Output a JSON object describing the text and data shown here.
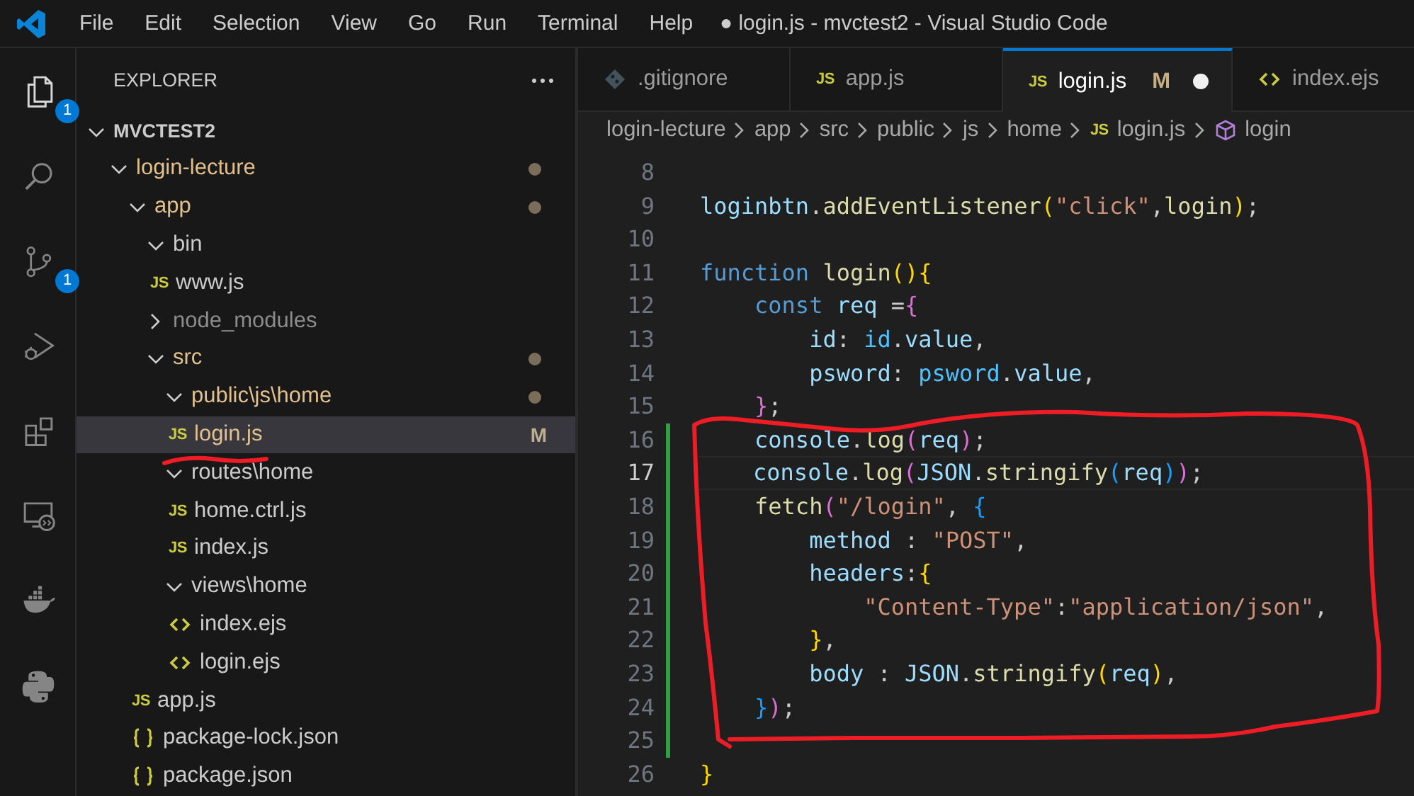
{
  "title_bar": {
    "menu": [
      "File",
      "Edit",
      "Selection",
      "View",
      "Go",
      "Run",
      "Terminal",
      "Help"
    ],
    "title": "● login.js - mvctest2 - Visual Studio Code"
  },
  "activity_bar": [
    {
      "kind": "explorer",
      "selected": true,
      "badge": "1"
    },
    {
      "kind": "search",
      "selected": false
    },
    {
      "kind": "source-control",
      "selected": false,
      "badge": "1"
    },
    {
      "kind": "run-debug",
      "selected": false
    },
    {
      "kind": "extensions",
      "selected": false
    },
    {
      "kind": "remote",
      "selected": false
    },
    {
      "kind": "docker",
      "selected": false
    },
    {
      "kind": "python",
      "selected": false
    }
  ],
  "explorer": {
    "title": "EXPLORER",
    "root": {
      "label": "MVCTEST2",
      "expanded": true
    },
    "tree": [
      {
        "label": "login-lecture",
        "kind": "folder",
        "expanded": true,
        "modified": true,
        "ignored": false,
        "selected": false,
        "children": [
          {
            "label": "app",
            "kind": "folder",
            "expanded": true,
            "modified": true,
            "ignored": false,
            "selected": false,
            "children": [
              {
                "label": "bin",
                "kind": "folder",
                "expanded": true,
                "modified": false,
                "ignored": false,
                "selected": false,
                "children": [
                  {
                    "label": "www.js",
                    "kind": "js",
                    "icon_label": "JS",
                    "modified": false,
                    "ignored": false,
                    "selected": false
                  }
                ]
              },
              {
                "label": "node_modules",
                "kind": "folder",
                "expanded": false,
                "modified": false,
                "ignored": true,
                "selected": false
              },
              {
                "label": "src",
                "kind": "folder",
                "expanded": true,
                "modified": true,
                "ignored": false,
                "selected": false,
                "children": [
                  {
                    "label": "public\\js\\home",
                    "kind": "folder",
                    "expanded": true,
                    "modified": true,
                    "ignored": false,
                    "selected": false,
                    "children": [
                      {
                        "label": "login.js",
                        "kind": "js",
                        "icon_label": "JS",
                        "modified": true,
                        "ignored": false,
                        "badge": "M",
                        "selected": true
                      }
                    ]
                  },
                  {
                    "label": "routes\\home",
                    "kind": "folder",
                    "expanded": true,
                    "modified": false,
                    "ignored": false,
                    "selected": false,
                    "children": [
                      {
                        "label": "home.ctrl.js",
                        "kind": "js",
                        "icon_label": "JS",
                        "modified": false,
                        "ignored": false,
                        "selected": false
                      },
                      {
                        "label": "index.js",
                        "kind": "js",
                        "icon_label": "JS",
                        "modified": false,
                        "ignored": false,
                        "selected": false
                      }
                    ]
                  },
                  {
                    "label": "views\\home",
                    "kind": "folder",
                    "expanded": true,
                    "modified": false,
                    "ignored": false,
                    "selected": false,
                    "children": [
                      {
                        "label": "index.ejs",
                        "kind": "ejs",
                        "modified": false,
                        "ignored": false,
                        "selected": false
                      },
                      {
                        "label": "login.ejs",
                        "kind": "ejs",
                        "modified": false,
                        "ignored": false,
                        "selected": false
                      }
                    ]
                  }
                ]
              },
              {
                "label": "app.js",
                "kind": "js",
                "icon_label": "JS",
                "modified": false,
                "ignored": false,
                "selected": false
              },
              {
                "label": "package-lock.json",
                "kind": "json",
                "modified": false,
                "ignored": false,
                "selected": false
              },
              {
                "label": "package.json",
                "kind": "json",
                "modified": false,
                "ignored": false,
                "selected": false
              }
            ]
          }
        ]
      }
    ]
  },
  "tabs": [
    {
      "label": ".gitignore",
      "kind": "git",
      "selected": false,
      "dirty": false
    },
    {
      "label": "app.js",
      "kind": "js",
      "icon_label": "JS",
      "selected": false,
      "dirty": false
    },
    {
      "label": "login.js",
      "kind": "js",
      "icon_label": "JS",
      "selected": true,
      "dirty": true,
      "badge": "M"
    },
    {
      "label": "index.ejs",
      "kind": "ejs",
      "selected": false,
      "dirty": false
    }
  ],
  "breadcrumbs": [
    {
      "label": "login-lecture"
    },
    {
      "label": "app"
    },
    {
      "label": "src"
    },
    {
      "label": "public"
    },
    {
      "label": "js"
    },
    {
      "label": "home"
    },
    {
      "label": "login.js",
      "kind": "js",
      "icon_label": "JS"
    },
    {
      "label": "login",
      "kind": "symbol"
    }
  ],
  "editor": {
    "lines": [
      {
        "number": "8",
        "modified": false,
        "current": false
      },
      {
        "number": "9",
        "modified": false,
        "current": false,
        "tokens": [
          {
            "t": "loginbtn",
            "kind": "var"
          },
          {
            "t": ".",
            "kind": "p"
          },
          {
            "t": "addEventListener",
            "kind": "fn"
          },
          {
            "t": "(",
            "kind": "b1"
          },
          {
            "t": "\"click\"",
            "kind": "str"
          },
          {
            "t": ",",
            "kind": "p"
          },
          {
            "t": "login",
            "kind": "fn"
          },
          {
            "t": ")",
            "kind": "b1"
          },
          {
            "t": ";",
            "kind": "p"
          }
        ]
      },
      {
        "number": "10",
        "modified": false,
        "current": false
      },
      {
        "number": "11",
        "modified": false,
        "current": false,
        "tokens": [
          {
            "t": "function ",
            "kind": "kw"
          },
          {
            "t": "login",
            "kind": "fn"
          },
          {
            "t": "(){",
            "kind": "b1"
          }
        ]
      },
      {
        "number": "12",
        "modified": false,
        "current": false,
        "tokens": [
          {
            "t": "    const ",
            "kind": "kw"
          },
          {
            "t": "req ",
            "kind": "var"
          },
          {
            "t": "=",
            "kind": "p"
          },
          {
            "t": "{",
            "kind": "b2"
          }
        ]
      },
      {
        "number": "13",
        "modified": false,
        "current": false,
        "tokens": [
          {
            "t": "        id",
            "kind": "var"
          },
          {
            "t": ": ",
            "kind": "p"
          },
          {
            "t": "id",
            "kind": "const"
          },
          {
            "t": ".",
            "kind": "p"
          },
          {
            "t": "value",
            "kind": "var"
          },
          {
            "t": ",",
            "kind": "p"
          }
        ]
      },
      {
        "number": "14",
        "modified": false,
        "current": false,
        "tokens": [
          {
            "t": "        psword",
            "kind": "var"
          },
          {
            "t": ": ",
            "kind": "p"
          },
          {
            "t": "psword",
            "kind": "const"
          },
          {
            "t": ".",
            "kind": "p"
          },
          {
            "t": "value",
            "kind": "var"
          },
          {
            "t": ",",
            "kind": "p"
          }
        ]
      },
      {
        "number": "15",
        "modified": false,
        "current": false,
        "tokens": [
          {
            "t": "    }",
            "kind": "b2"
          },
          {
            "t": ";",
            "kind": "p"
          }
        ]
      },
      {
        "number": "16",
        "modified": true,
        "current": false,
        "tokens": [
          {
            "t": "    console",
            "kind": "var"
          },
          {
            "t": ".",
            "kind": "p"
          },
          {
            "t": "log",
            "kind": "fn"
          },
          {
            "t": "(",
            "kind": "b2"
          },
          {
            "t": "req",
            "kind": "var"
          },
          {
            "t": ")",
            "kind": "b2"
          },
          {
            "t": ";",
            "kind": "p"
          }
        ]
      },
      {
        "number": "17",
        "modified": true,
        "current": true,
        "tokens": [
          {
            "t": "    console",
            "kind": "var"
          },
          {
            "t": ".",
            "kind": "p"
          },
          {
            "t": "log",
            "kind": "fn"
          },
          {
            "t": "(",
            "kind": "b2"
          },
          {
            "t": "JSON",
            "kind": "var"
          },
          {
            "t": ".",
            "kind": "p"
          },
          {
            "t": "stringify",
            "kind": "fn"
          },
          {
            "t": "(",
            "kind": "b3"
          },
          {
            "t": "req",
            "kind": "var"
          },
          {
            "t": ")",
            "kind": "b3"
          },
          {
            "t": ")",
            "kind": "b2"
          },
          {
            "t": ";",
            "kind": "p"
          }
        ]
      },
      {
        "number": "18",
        "modified": true,
        "current": false,
        "tokens": [
          {
            "t": "    fetch",
            "kind": "fn"
          },
          {
            "t": "(",
            "kind": "b2"
          },
          {
            "t": "\"/login\"",
            "kind": "str"
          },
          {
            "t": ", ",
            "kind": "p"
          },
          {
            "t": "{",
            "kind": "b3"
          }
        ]
      },
      {
        "number": "19",
        "modified": true,
        "current": false,
        "tokens": [
          {
            "t": "        method",
            "kind": "var"
          },
          {
            "t": " : ",
            "kind": "p"
          },
          {
            "t": "\"POST\"",
            "kind": "str"
          },
          {
            "t": ",",
            "kind": "p"
          }
        ]
      },
      {
        "number": "20",
        "modified": true,
        "current": false,
        "tokens": [
          {
            "t": "        headers",
            "kind": "var"
          },
          {
            "t": ":",
            "kind": "p"
          },
          {
            "t": "{",
            "kind": "b1"
          }
        ]
      },
      {
        "number": "21",
        "modified": true,
        "current": false,
        "tokens": [
          {
            "t": "            \"Content-Type\"",
            "kind": "str"
          },
          {
            "t": ":",
            "kind": "p"
          },
          {
            "t": "\"application/json\"",
            "kind": "str"
          },
          {
            "t": ",",
            "kind": "p"
          }
        ]
      },
      {
        "number": "22",
        "modified": true,
        "current": false,
        "tokens": [
          {
            "t": "        }",
            "kind": "b1"
          },
          {
            "t": ",",
            "kind": "p"
          }
        ]
      },
      {
        "number": "23",
        "modified": true,
        "current": false,
        "tokens": [
          {
            "t": "        body",
            "kind": "var"
          },
          {
            "t": " : ",
            "kind": "p"
          },
          {
            "t": "JSON",
            "kind": "var"
          },
          {
            "t": ".",
            "kind": "p"
          },
          {
            "t": "stringify",
            "kind": "fn"
          },
          {
            "t": "(",
            "kind": "b1"
          },
          {
            "t": "req",
            "kind": "var"
          },
          {
            "t": ")",
            "kind": "b1"
          },
          {
            "t": ",",
            "kind": "p"
          }
        ]
      },
      {
        "number": "24",
        "modified": true,
        "current": false,
        "tokens": [
          {
            "t": "    }",
            "kind": "b3"
          },
          {
            "t": ")",
            "kind": "b2"
          },
          {
            "t": ";",
            "kind": "p"
          }
        ]
      },
      {
        "number": "25",
        "modified": true,
        "current": false
      },
      {
        "number": "26",
        "modified": false,
        "current": false,
        "tokens": [
          {
            "t": "}",
            "kind": "b1"
          }
        ]
      }
    ]
  }
}
